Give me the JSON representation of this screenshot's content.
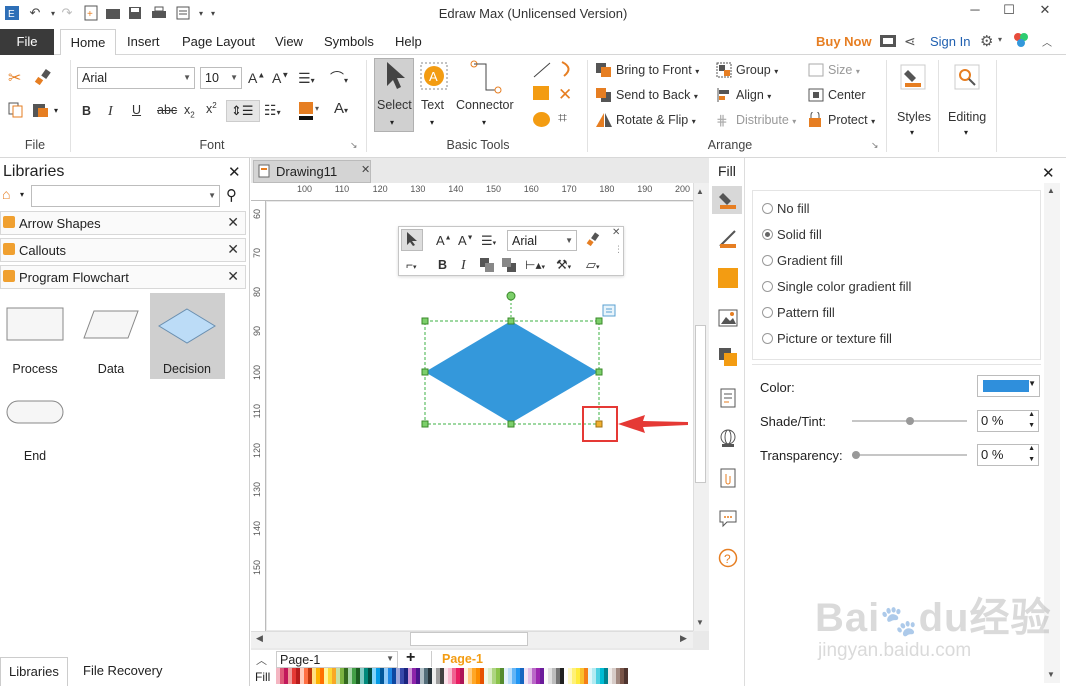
{
  "app": {
    "title": "Edraw Max (Unlicensed Version)"
  },
  "menu": {
    "file": "File",
    "tabs": [
      "Home",
      "Insert",
      "Page Layout",
      "View",
      "Symbols",
      "Help"
    ],
    "buy_now": "Buy Now",
    "sign_in": "Sign In"
  },
  "ribbon": {
    "file_group": "File",
    "font": {
      "name": "Arial",
      "size": "10",
      "group": "Font"
    },
    "basic_tools": {
      "select": "Select",
      "text": "Text",
      "connector": "Connector",
      "group": "Basic Tools"
    },
    "arrange": {
      "bring_to_front": "Bring to Front",
      "send_to_back": "Send to Back",
      "rotate_flip": "Rotate & Flip",
      "group_btn": "Group",
      "align": "Align",
      "distribute": "Distribute",
      "size": "Size",
      "center": "Center",
      "protect": "Protect",
      "group": "Arrange"
    },
    "styles": "Styles",
    "editing": "Editing"
  },
  "libraries": {
    "title": "Libraries",
    "sections": [
      "Arrow Shapes",
      "Callouts",
      "Program Flowchart"
    ],
    "shapes": [
      "Process",
      "Data",
      "Decision",
      "End"
    ]
  },
  "document": {
    "tab": "Drawing11",
    "hruler": [
      "100",
      "110",
      "120",
      "130",
      "140",
      "150",
      "160",
      "170",
      "180",
      "190",
      "200"
    ],
    "vruler": [
      "60",
      "70",
      "80",
      "90",
      "100",
      "110",
      "120",
      "130",
      "140",
      "150"
    ],
    "float_font": "Arial",
    "shape_color": "#3498db"
  },
  "bottom": {
    "page_select": "Page-1",
    "page_tab": "Page-1",
    "fill_label": "Fill",
    "libraries_tab": "Libraries",
    "file_recovery_tab": "File Recovery"
  },
  "fill_panel": {
    "title": "Fill",
    "options": [
      "No fill",
      "Solid fill",
      "Gradient fill",
      "Single color gradient fill",
      "Pattern fill",
      "Picture or texture fill"
    ],
    "selected": "Solid fill",
    "color_label": "Color:",
    "color_value": "#2f8fdc",
    "shade_label": "Shade/Tint:",
    "shade_value": "0 %",
    "transparency_label": "Transparency:",
    "transparency_value": "0 %"
  },
  "annotation": {
    "color": "#e53935"
  },
  "watermark": {
    "brand": "Baidu经验",
    "url": "jingyan.baidu.com"
  }
}
